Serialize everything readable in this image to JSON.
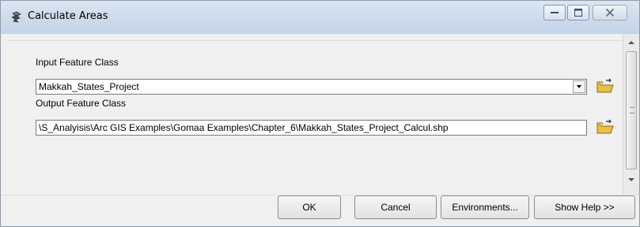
{
  "window": {
    "title": "Calculate Areas",
    "icon": "toolbox-tool-icon"
  },
  "form": {
    "input_label": "Input Feature Class",
    "input_value": "Makkah_States_Project",
    "output_label": "Output Feature Class",
    "output_value": "\\S_Analyisis\\Arc GIS Examples\\Gomaa Examples\\Chapter_6\\Makkah_States_Project_Calcul.shp"
  },
  "buttons": {
    "ok": "OK",
    "cancel": "Cancel",
    "environments": "Environments...",
    "show_help": "Show Help >>"
  },
  "colors": {
    "titlebar": "#cfdced",
    "folder": "#e8c042"
  }
}
